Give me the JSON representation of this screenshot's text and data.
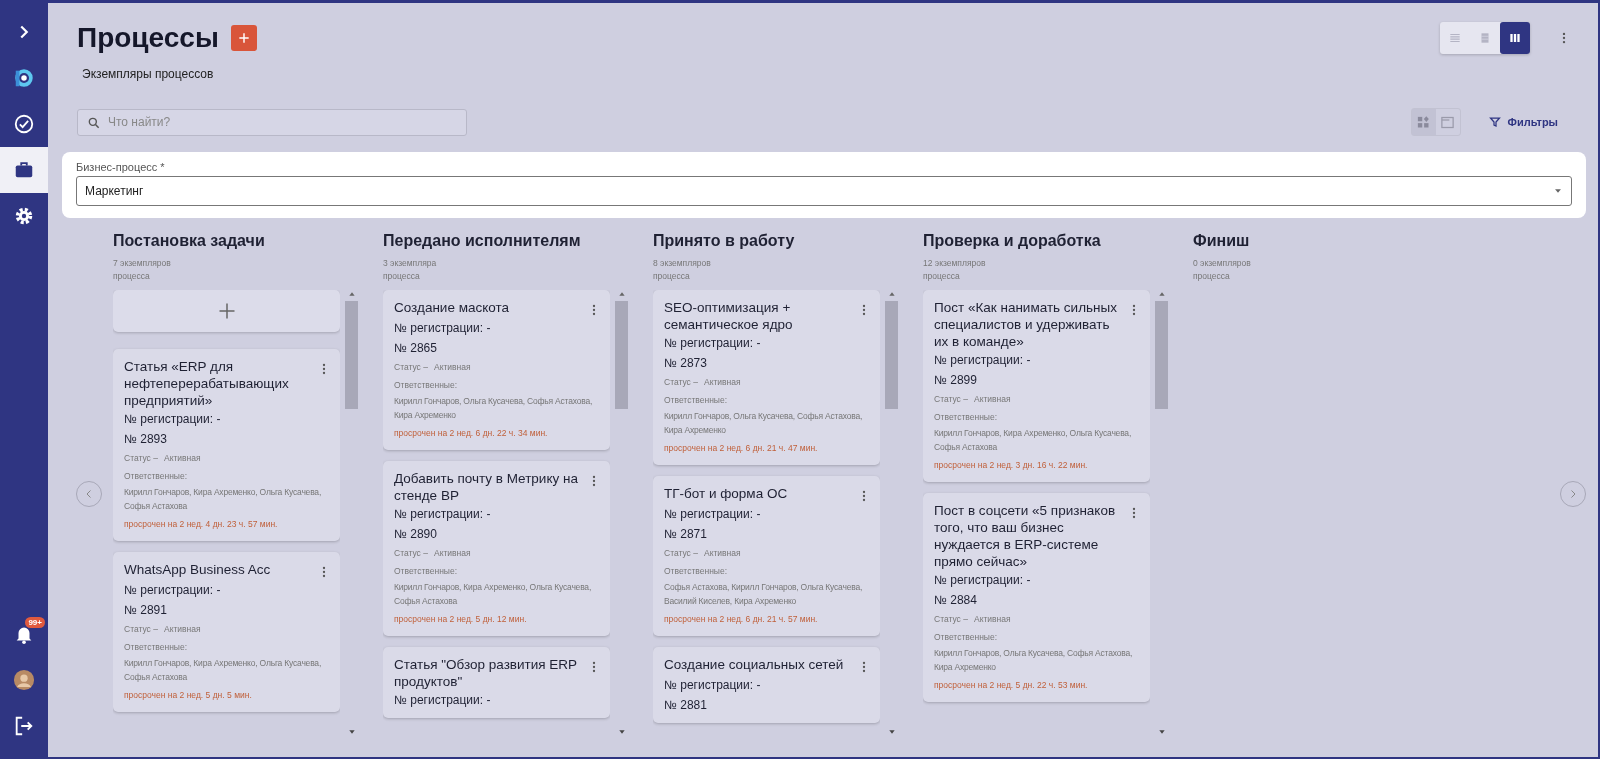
{
  "sidebar": {
    "top_items": [
      {
        "kind": "expand",
        "selected": false
      },
      {
        "kind": "logo",
        "selected": false
      },
      {
        "kind": "tasks",
        "selected": false
      },
      {
        "kind": "processes",
        "selected": true
      },
      {
        "kind": "settings",
        "selected": false
      }
    ],
    "bottom_items": [
      {
        "kind": "notifications",
        "badge": "99+"
      },
      {
        "kind": "avatar"
      },
      {
        "kind": "logout"
      }
    ]
  },
  "header": {
    "title": "Процессы",
    "subtitle": "Экземпляры процессов",
    "search": {
      "placeholder": "Что найти?"
    },
    "view_modes": [
      {
        "kind": "list",
        "selected": false
      },
      {
        "kind": "table",
        "selected": false
      },
      {
        "kind": "board",
        "selected": true
      }
    ],
    "layout_modes": [
      {
        "kind": "tiles",
        "selected": true
      },
      {
        "kind": "panel",
        "selected": false
      }
    ],
    "filters_label": "Фильтры"
  },
  "business_process": {
    "label": "Бизнес-процесс *",
    "value": "Маркетинг"
  },
  "columns": [
    {
      "title": "Постановка задачи",
      "count": "7 экземпляров процесса",
      "add_card": true,
      "cards": [
        {
          "title": "Статья «ERP для нефтеперерабатывающих предприятий»",
          "registration": "№ регистрации: -",
          "number": "№ 2893",
          "status_label": "Статус –",
          "status": "Активная",
          "responsible_label": "Ответственные:",
          "responsible": "Кирилл Гончаров, Кира Ахременко, Ольга Кусачева, Софья Астахова",
          "overdue": "просрочен на 2 нед. 4 дн. 23 ч. 57 мин."
        },
        {
          "title": "WhatsApp Business Acc",
          "registration": "№ регистрации: -",
          "number": "№ 2891",
          "status_label": "Статус –",
          "status": "Активная",
          "responsible_label": "Ответственные:",
          "responsible": "Кирилл Гончаров, Кира Ахременко, Ольга Кусачева, Софья Астахова",
          "overdue": "просрочен на 2 нед. 5 дн. 5 мин."
        }
      ]
    },
    {
      "title": "Передано исполнителям",
      "count": "3 экземпляра процесса",
      "add_card": false,
      "cards": [
        {
          "title": "Создание маскота",
          "registration": "№ регистрации: -",
          "number": "№ 2865",
          "status_label": "Статус –",
          "status": "Активная",
          "responsible_label": "Ответственные:",
          "responsible": "Кирилл Гончаров, Ольга Кусачева, Софья Астахова, Кира Ахременко",
          "overdue": "просрочен на 2 нед. 6 дн. 22 ч. 34 мин."
        },
        {
          "title": "Добавить почту в Метрику на стенде ВР",
          "registration": "№ регистрации: -",
          "number": "№ 2890",
          "status_label": "Статус –",
          "status": "Активная",
          "responsible_label": "Ответственные:",
          "responsible": "Кирилл Гончаров, Кира Ахременко, Ольга Кусачева, Софья Астахова",
          "overdue": "просрочен на 2 нед. 5 дн. 12 мин."
        },
        {
          "title": "Статья \"Обзор развития ERP продуктов\"",
          "registration": "№ регистрации: -"
        }
      ]
    },
    {
      "title": "Принято в работу",
      "count": "8 экземпляров процесса",
      "add_card": false,
      "cards": [
        {
          "title": "SEO-оптимизация + семантическое ядро",
          "registration": "№ регистрации: -",
          "number": "№ 2873",
          "status_label": "Статус –",
          "status": "Активная",
          "responsible_label": "Ответственные:",
          "responsible": "Кирилл Гончаров, Ольга Кусачева, Софья Астахова, Кира Ахременко",
          "overdue": "просрочен на 2 нед. 6 дн. 21 ч. 47 мин."
        },
        {
          "title": "ТГ-бот и форма ОС",
          "registration": "№ регистрации: -",
          "number": "№ 2871",
          "status_label": "Статус –",
          "status": "Активная",
          "responsible_label": "Ответственные:",
          "responsible": "Софья Астахова, Кирилл Гончаров, Ольга Кусачева, Василий Киселев, Кира Ахременко",
          "overdue": "просрочен на 2 нед. 6 дн. 21 ч. 57 мин."
        },
        {
          "title": "Создание социальных сетей",
          "registration": "№ регистрации: -",
          "number": "№ 2881"
        }
      ]
    },
    {
      "title": "Проверка и доработка",
      "count": "12 экземпляров процесса",
      "add_card": false,
      "cards": [
        {
          "title": "Пост «Как нанимать сильных специалистов и удерживать их в команде»",
          "registration": "№ регистрации: -",
          "number": "№ 2899",
          "status_label": "Статус –",
          "status": "Активная",
          "responsible_label": "Ответственные:",
          "responsible": "Кирилл Гончаров, Кира Ахременко, Ольга Кусачева, Софья Астахова",
          "overdue": "просрочен на 2 нед. 3 дн. 16 ч. 22 мин."
        },
        {
          "title": "Пост в соцсети «5 признаков того, что ваш бизнес нуждается в ERP-системе прямо сейчас»",
          "registration": "№ регистрации: -",
          "number": "№ 2884",
          "status_label": "Статус –",
          "status": "Активная",
          "responsible_label": "Ответственные:",
          "responsible": "Кирилл Гончаров, Ольга Кусачева, Софья Астахова, Кира Ахременко",
          "overdue": "просрочен на 2 нед. 5 дн. 22 ч. 53 мин."
        }
      ]
    },
    {
      "title": "Финиш",
      "count": "0 экземпляров процесса",
      "add_card": false
    }
  ]
}
